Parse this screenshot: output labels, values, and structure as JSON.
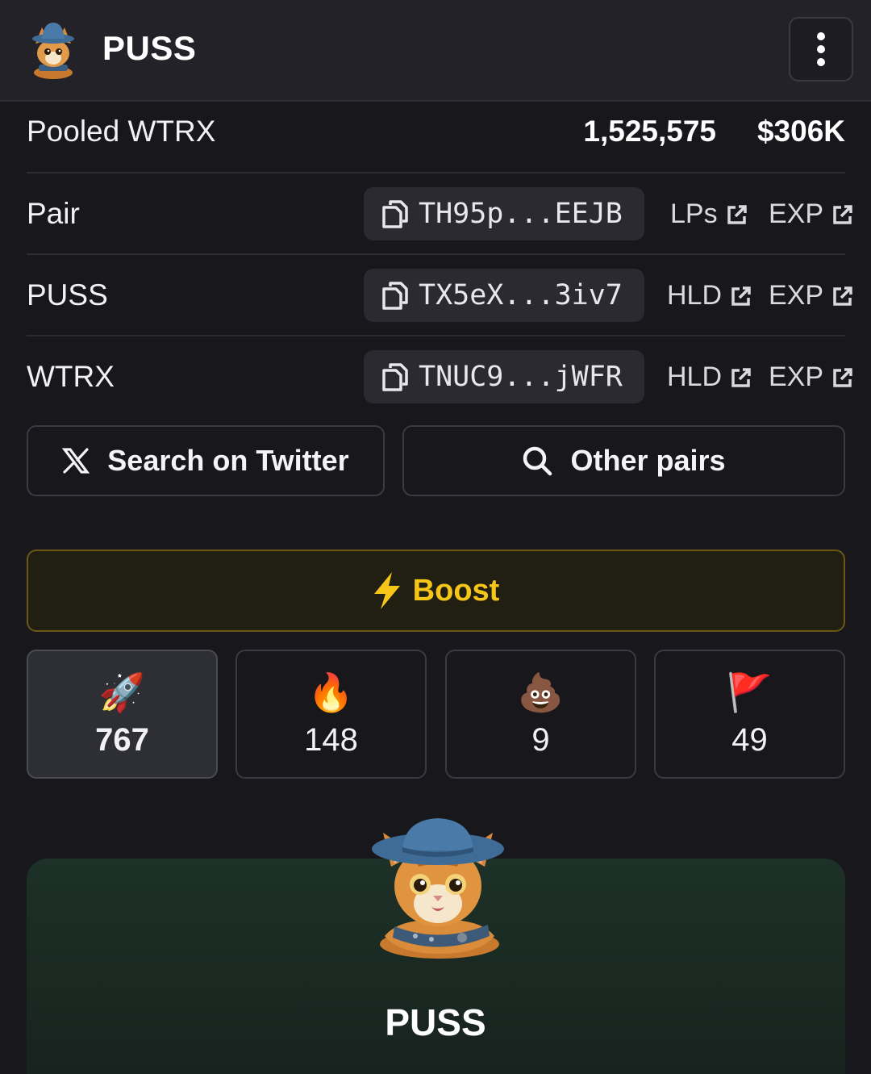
{
  "header": {
    "title": "PUSS",
    "logo_icon": "cat-wizard-logo",
    "menu_icon": "more-vertical-icon"
  },
  "pooled": {
    "label": "Pooled WTRX",
    "amount": "1,525,575",
    "usd": "$306K"
  },
  "rows": [
    {
      "label": "Pair",
      "address": "TH95p...EEJB",
      "link1": "LPs",
      "link2": "EXP"
    },
    {
      "label": "PUSS",
      "address": "TX5eX...3iv7",
      "link1": "HLD",
      "link2": "EXP"
    },
    {
      "label": "WTRX",
      "address": "TNUC9...jWFR",
      "link1": "HLD",
      "link2": "EXP"
    }
  ],
  "buttons": {
    "twitter": "Search on Twitter",
    "other_pairs": "Other pairs",
    "boost": "Boost"
  },
  "reactions": [
    {
      "emoji": "🚀",
      "count": "767",
      "icon": "rocket-icon"
    },
    {
      "emoji": "🔥",
      "count": "148",
      "icon": "fire-icon"
    },
    {
      "emoji": "💩",
      "count": "9",
      "icon": "poop-icon"
    },
    {
      "emoji": "🚩",
      "count": "49",
      "icon": "red-flag-icon"
    }
  ],
  "token": {
    "name": "PUSS"
  },
  "colors": {
    "accent": "#f5c518",
    "background": "#17171c",
    "card": "#1d3128"
  }
}
